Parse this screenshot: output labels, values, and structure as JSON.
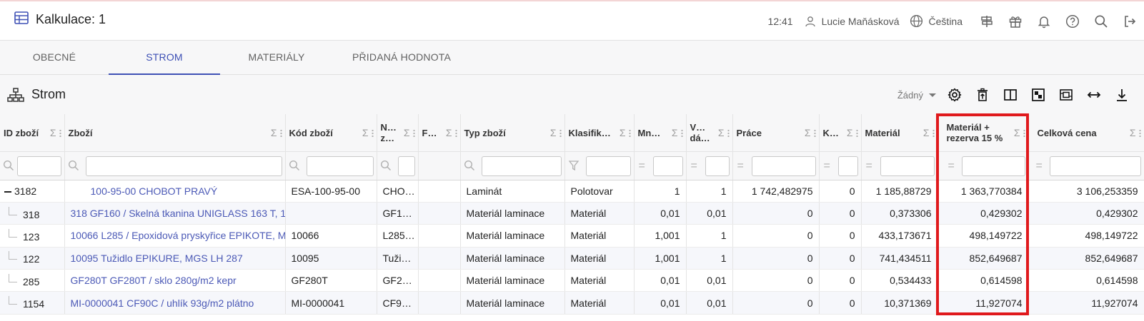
{
  "app": {
    "title": "Kalkulace: 1",
    "time": "12:41",
    "user": "Lucie Maňásková",
    "language": "Čeština"
  },
  "tabs": [
    {
      "label": "OBECNÉ",
      "active": false
    },
    {
      "label": "STROM",
      "active": true
    },
    {
      "label": "MATERIÁLY",
      "active": false
    },
    {
      "label": "PŘIDANÁ HODNOTA",
      "active": false
    }
  ],
  "panel": {
    "title": "Strom",
    "dropdown_value": "Žádný"
  },
  "columns": [
    {
      "label": "ID zboží"
    },
    {
      "label": "Zboží"
    },
    {
      "label": "Kód zboží"
    },
    {
      "label": "N… z…"
    },
    {
      "label": "F…"
    },
    {
      "label": "Typ zboží"
    },
    {
      "label": "Klasifik…"
    },
    {
      "label": "Mn…"
    },
    {
      "label": "V… dá…"
    },
    {
      "label": "Práce"
    },
    {
      "label": "K…"
    },
    {
      "label": "Materiál"
    },
    {
      "label": "Materiál + rezerva 15 %"
    },
    {
      "label": "Celková cena"
    }
  ],
  "rows": [
    {
      "id": "3182",
      "zbozi": "100-95-00 CHOBOT PRAVÝ",
      "kod": "ESA-100-95-00",
      "n": "CHO…",
      "f": "",
      "typ": "Laminát",
      "klas": "Polotovar",
      "mn": "1",
      "v": "1",
      "prace": "1 742,482975",
      "k": "0",
      "material": "1 185,88729",
      "rezerva": "1 363,770384",
      "celkem": "3 106,253359"
    },
    {
      "id": "318",
      "zbozi": "318 GF160 / Skelná tkanina UNIGLASS 163 T, 1…",
      "kod": "",
      "n": "GF1…",
      "f": "",
      "typ": "Materiál laminace",
      "klas": "Materiál",
      "mn": "0,01",
      "v": "0,01",
      "prace": "0",
      "k": "0",
      "material": "0,373306",
      "rezerva": "0,429302",
      "celkem": "0,429302"
    },
    {
      "id": "123",
      "zbozi": "10066 L285 / Epoxidová pryskyřice EPIKOTE, M…",
      "kod": "10066",
      "n": "L285…",
      "f": "",
      "typ": "Materiál laminace",
      "klas": "Materiál",
      "mn": "1,001",
      "v": "1",
      "prace": "0",
      "k": "0",
      "material": "433,173671",
      "rezerva": "498,149722",
      "celkem": "498,149722"
    },
    {
      "id": "122",
      "zbozi": "10095 Tužidlo EPIKURE, MGS LH 287",
      "kod": "10095",
      "n": "Tuži…",
      "f": "",
      "typ": "Materiál laminace",
      "klas": "Materiál",
      "mn": "1,001",
      "v": "1",
      "prace": "0",
      "k": "0",
      "material": "741,434511",
      "rezerva": "852,649687",
      "celkem": "852,649687"
    },
    {
      "id": "285",
      "zbozi": "GF280T GF280T / sklo 280g/m2 kepr",
      "kod": "GF280T",
      "n": "GF2…",
      "f": "",
      "typ": "Materiál laminace",
      "klas": "Materiál",
      "mn": "0,01",
      "v": "0,01",
      "prace": "0",
      "k": "0",
      "material": "0,534433",
      "rezerva": "0,614598",
      "celkem": "0,614598"
    },
    {
      "id": "1154",
      "zbozi": "MI-0000041 CF90C / uhlík 93g/m2 plátno",
      "kod": "MI-0000041",
      "n": "CF9…",
      "f": "",
      "typ": "Materiál laminace",
      "klas": "Materiál",
      "mn": "0,01",
      "v": "0,01",
      "prace": "0",
      "k": "0",
      "material": "10,371369",
      "rezerva": "11,927074",
      "celkem": "11,927074"
    }
  ],
  "colors": {
    "accent": "#3f51b5",
    "link": "#4b59b6",
    "highlight": "#e0191c"
  }
}
